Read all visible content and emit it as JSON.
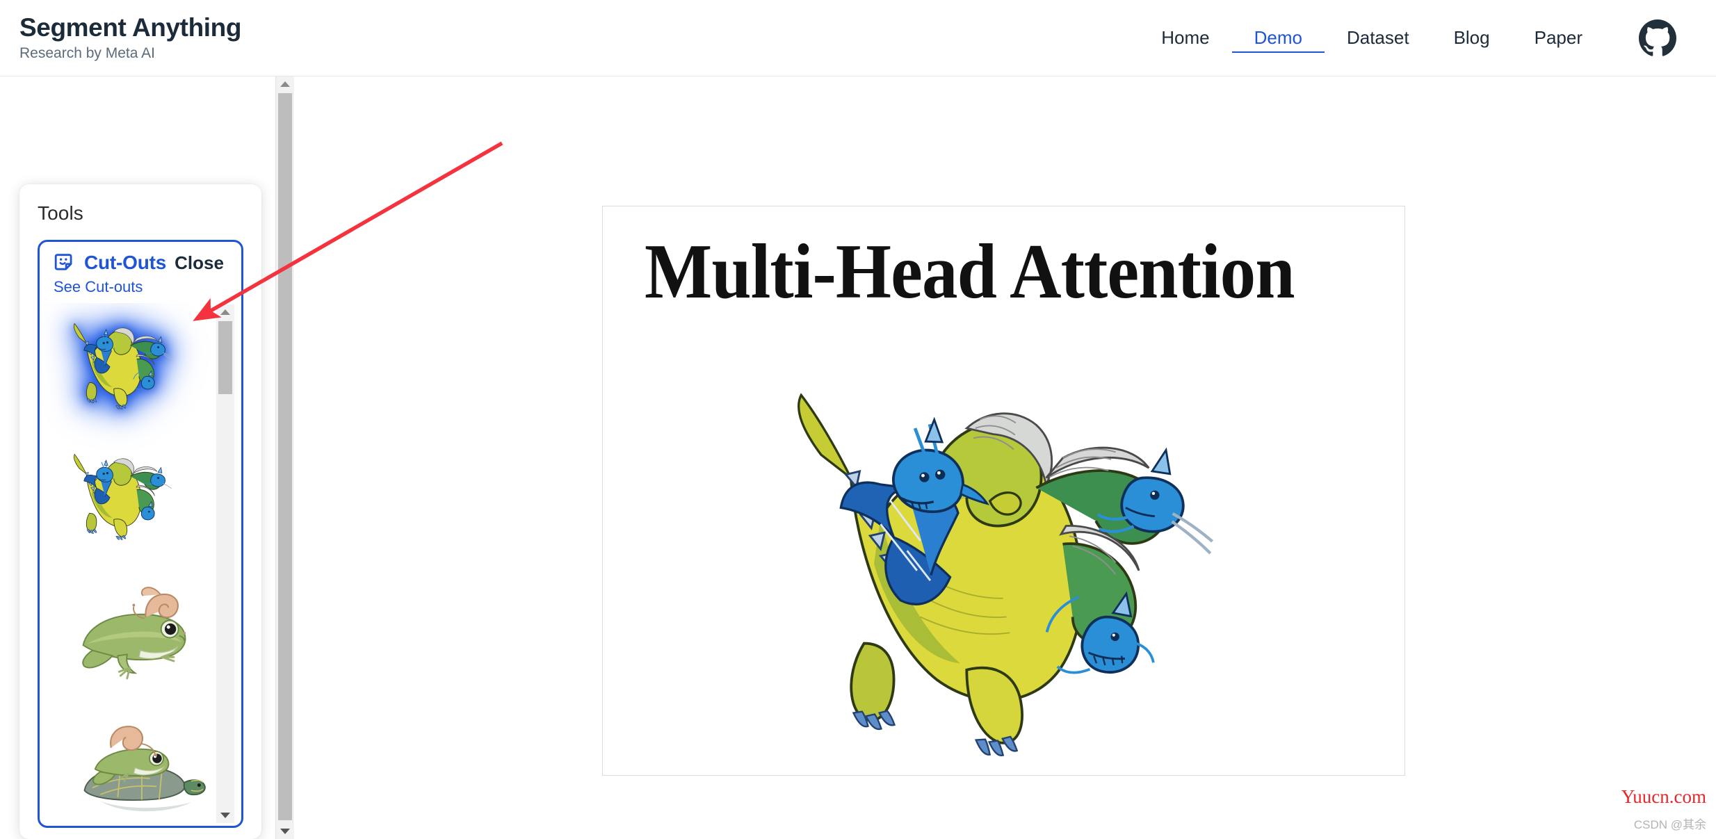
{
  "header": {
    "brand_title": "Segment Anything",
    "brand_subtitle": "Research by Meta AI",
    "nav": [
      {
        "label": "Home",
        "active": false
      },
      {
        "label": "Demo",
        "active": true
      },
      {
        "label": "Dataset",
        "active": false
      },
      {
        "label": "Blog",
        "active": false
      },
      {
        "label": "Paper",
        "active": false
      }
    ],
    "github_icon": "github-icon"
  },
  "tools_panel": {
    "heading": "Tools",
    "cutouts": {
      "icon": "sticker-face-icon",
      "title": "Cut-Outs",
      "close_label": "Close",
      "link_label": "See Cut-outs",
      "thumbnails": [
        {
          "name": "three-headed-hydra-cutout",
          "selected": true
        },
        {
          "name": "three-headed-hydra-cutout",
          "selected": false
        },
        {
          "name": "frog-with-snail-cutout",
          "selected": false
        },
        {
          "name": "frog-on-turtle-cutout",
          "selected": false
        }
      ]
    }
  },
  "image_stage": {
    "title": "Multi-Head Attention",
    "artwork_name": "three-headed-hydra-illustration"
  },
  "scrollbars": {
    "page": {
      "name": "page-scrollbar",
      "up_arrow": "chevron-up-icon",
      "down_arrow": "chevron-down-icon"
    },
    "thumbnails": {
      "name": "thumbnail-list-scrollbar",
      "up_arrow": "chevron-up-icon",
      "down_arrow": "chevron-down-icon"
    }
  },
  "annotation": {
    "name": "red-arrow-annotation",
    "color": "#f5333f",
    "points_to": "first-cutout-thumbnail"
  },
  "watermark": {
    "site": "Yuucn.com",
    "credit": "CSDN @其余",
    "site_color": "#e8262b",
    "credit_color": "#b4b4b4"
  },
  "colors": {
    "accent_blue": "#1f54d6",
    "text_dark": "#1c2b3a",
    "text_muted": "#5c6b7a",
    "scrollbar_thumb": "#bdbdbd",
    "panel_bg": "#ffffff"
  }
}
